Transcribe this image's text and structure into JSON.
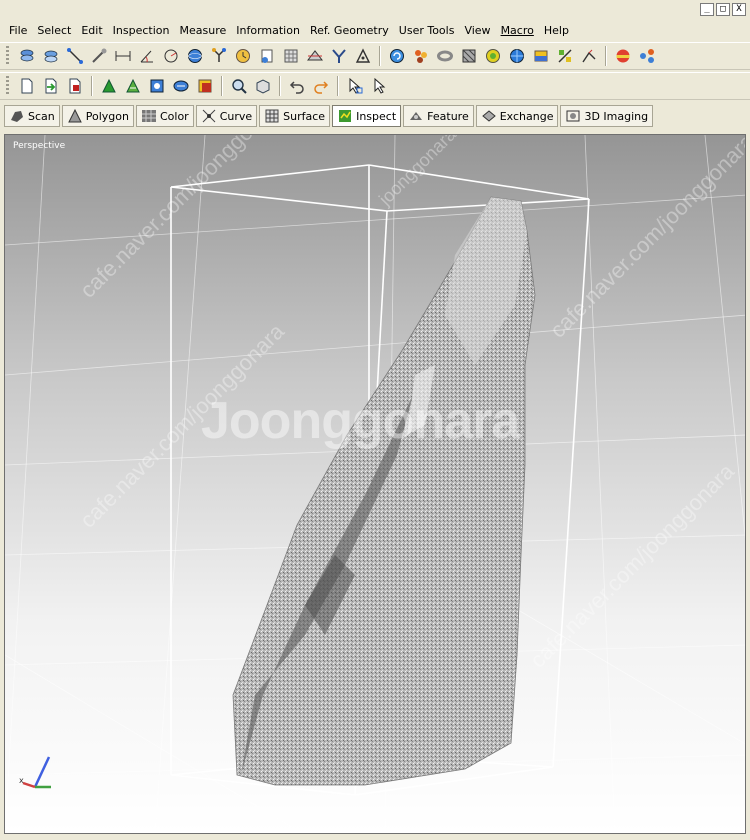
{
  "window": {
    "minimize": "_",
    "maximize": "□",
    "close": "X"
  },
  "menubar": {
    "items": [
      {
        "label": "File"
      },
      {
        "label": "Select"
      },
      {
        "label": "Edit"
      },
      {
        "label": "Inspection"
      },
      {
        "label": "Measure"
      },
      {
        "label": "Information"
      },
      {
        "label": "Ref. Geometry"
      },
      {
        "label": "User Tools"
      },
      {
        "label": "View"
      },
      {
        "label": "Macro"
      },
      {
        "label": "Help"
      }
    ]
  },
  "modes": {
    "items": [
      {
        "label": "Scan"
      },
      {
        "label": "Polygon"
      },
      {
        "label": "Color"
      },
      {
        "label": "Curve"
      },
      {
        "label": "Surface"
      },
      {
        "label": "Inspect"
      },
      {
        "label": "Feature"
      },
      {
        "label": "Exchange"
      },
      {
        "label": "3D Imaging"
      }
    ],
    "active": "Inspect"
  },
  "viewport": {
    "view_label": "Perspective",
    "watermark": "Joonggonara",
    "watermark_diag": [
      "cafe.naver.com/joonggonara",
      "cafe.naver.com/joonggonara",
      "cafe.naver.com/joonggonara",
      "cafe.naver.com/joonggonara",
      "joonggonara"
    ]
  },
  "colors": {
    "chrome": "#ece9d8",
    "accent": "#0a246a",
    "axis_x": "#d04040",
    "axis_y": "#40a040",
    "axis_z": "#4060e0"
  }
}
